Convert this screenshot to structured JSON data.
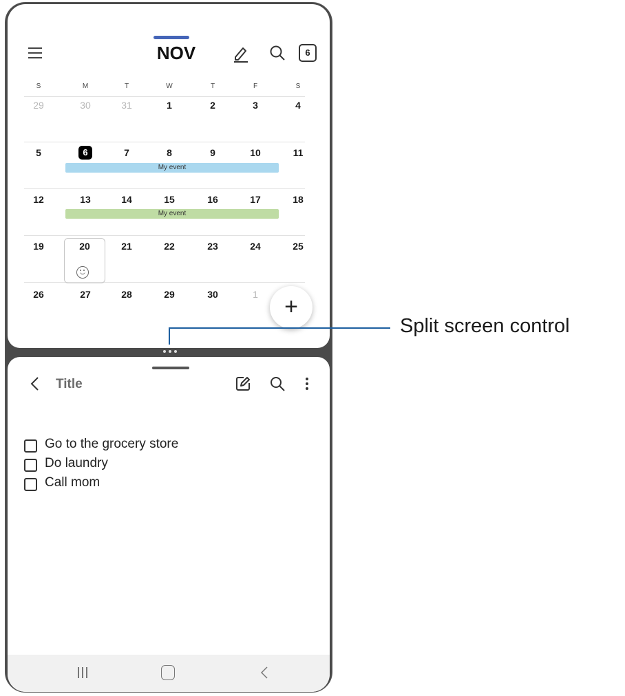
{
  "calendar": {
    "month": "NOV",
    "today_button": "6",
    "weekdays": [
      "S",
      "M",
      "T",
      "W",
      "T",
      "F",
      "S"
    ],
    "weeks": [
      [
        "29",
        "30",
        "31",
        "1",
        "2",
        "3",
        "4"
      ],
      [
        "5",
        "6",
        "7",
        "8",
        "9",
        "10",
        "11"
      ],
      [
        "12",
        "13",
        "14",
        "15",
        "16",
        "17",
        "18"
      ],
      [
        "19",
        "20",
        "21",
        "22",
        "23",
        "24",
        "25"
      ],
      [
        "26",
        "27",
        "28",
        "29",
        "30",
        "1",
        ""
      ]
    ],
    "events": [
      {
        "label": "My event",
        "color": "#aad8ef"
      },
      {
        "label": "My event",
        "color": "#bfdca4"
      }
    ],
    "fab_label": "+",
    "colors": {
      "today_bg": "#000000",
      "indicator": "#4565b8"
    }
  },
  "notes": {
    "title": "Title",
    "tasks": [
      "Go to the grocery store",
      "Do laundry",
      "Call mom"
    ]
  },
  "icons": {
    "menu": "menu-icon",
    "pen": "pen-icon",
    "search": "search-icon",
    "back": "back-icon",
    "edit": "edit-icon",
    "more": "more-icon",
    "recents": "recents-icon",
    "home": "home-icon",
    "nav_back": "nav-back-icon"
  },
  "callout": {
    "label": "Split screen control",
    "color": "#1d5fa0"
  }
}
